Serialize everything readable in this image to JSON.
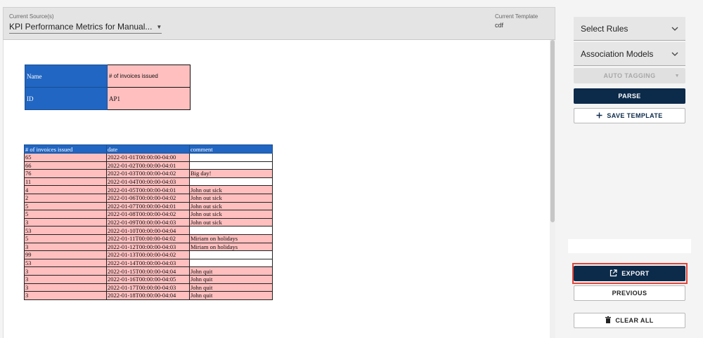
{
  "header": {
    "source_label": "Current Source(s)",
    "source_value": "KPI Performance Metrics for Manual...",
    "template_label": "Current Template",
    "template_value": "cdf"
  },
  "meta_table": {
    "rows": [
      {
        "key": "Name",
        "value": "# of invoices issued"
      },
      {
        "key": "ID",
        "value": "AP1"
      }
    ]
  },
  "data_table": {
    "columns": [
      "# of invoices issued",
      "date",
      "comment"
    ],
    "rows": [
      [
        "65",
        "2022-01-01T00:00:00-04:00",
        ""
      ],
      [
        "66",
        "2022-01-02T00:00:00-04:01",
        ""
      ],
      [
        "76",
        "2022-01-03T00:00:00-04:02",
        "Big day!"
      ],
      [
        "11",
        "2022-01-04T00:00:00-04:03",
        ""
      ],
      [
        "4",
        "2022-01-05T00:00:00-04:01",
        "John out sick"
      ],
      [
        "2",
        "2022-01-06T00:00:00-04:02",
        "John out sick"
      ],
      [
        "5",
        "2022-01-07T00:00:00-04:01",
        "John out sick"
      ],
      [
        "5",
        "2022-01-08T00:00:00-04:02",
        "John out sick"
      ],
      [
        "3",
        "2022-01-09T00:00:00-04:03",
        "John out sick"
      ],
      [
        "53",
        "2022-01-10T00:00:00-04:04",
        ""
      ],
      [
        "5",
        "2022-01-11T00:00:00-04:02",
        "Miriam on holidays"
      ],
      [
        "3",
        "2022-01-12T00:00:00-04:03",
        "Miriam on holidays"
      ],
      [
        "99",
        "2022-01-13T00:00:00-04:02",
        ""
      ],
      [
        "53",
        "2022-01-14T00:00:00-04:03",
        ""
      ],
      [
        "3",
        "2022-01-15T00:00:00-04:04",
        "John quit"
      ],
      [
        "3",
        "2022-01-16T00:00:00-04:05",
        "John quit"
      ],
      [
        "3",
        "2022-01-17T00:00:00-04:03",
        "John quit"
      ],
      [
        "3",
        "2022-01-18T00:00:00-04:04",
        "John quit"
      ]
    ]
  },
  "sidebar": {
    "select_rules": "Select Rules",
    "association_models": "Association Models",
    "auto_tagging": "AUTO TAGGING",
    "parse": "PARSE",
    "save_template": "SAVE TEMPLATE",
    "export": "EXPORT",
    "previous": "PREVIOUS",
    "clear_all": "CLEAR ALL"
  },
  "colors": {
    "primary": "#0c2a4a",
    "header_blue": "#2166c2",
    "cell_pink": "#ffbfbf",
    "highlight_red": "#e0453a"
  },
  "icons": {
    "source_dropdown": "caret-down-icon",
    "select_chevron": "chevron-down-icon",
    "save": "plus-icon",
    "export": "open-external-icon",
    "clear": "trash-icon"
  }
}
